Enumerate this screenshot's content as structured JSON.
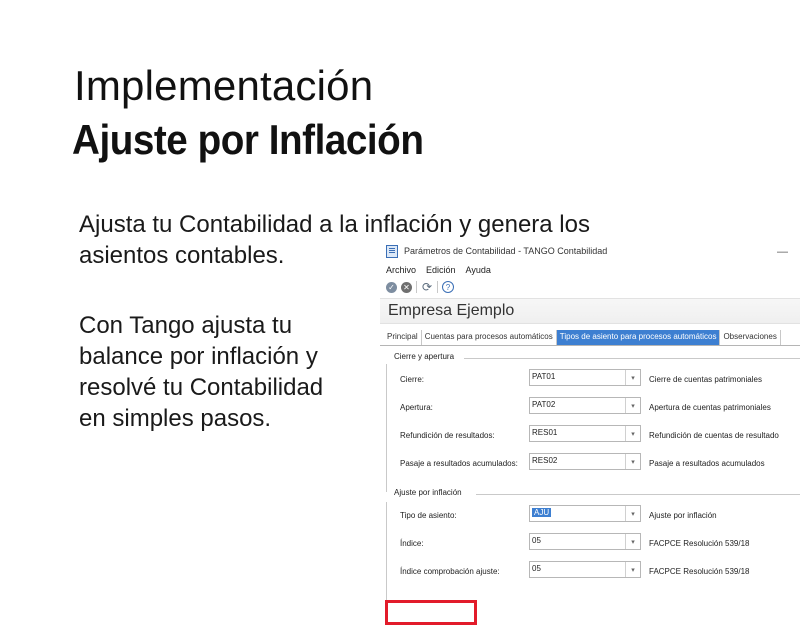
{
  "slide": {
    "title_line1": "Implementación",
    "title_line2": "Ajuste por Inflación",
    "paragraph1_line1": "Ajusta tu Contabilidad a la inflación y genera los",
    "paragraph1_line2": "asientos contables.",
    "paragraph2_line1": "Con Tango ajusta tu",
    "paragraph2_line2": "balance por inflación y",
    "paragraph2_line3": "resolvé tu Contabilidad",
    "paragraph2_line4": "en simples pasos."
  },
  "window": {
    "title": "Parámetros de Contabilidad - TANGO Contabilidad",
    "minimize_glyph": "—",
    "menu": [
      "Archivo",
      "Edición",
      "Ayuda"
    ],
    "toolbar_icons": [
      "ok-icon",
      "cancel-icon",
      "refresh-icon",
      "help-icon"
    ],
    "company": "Empresa Ejemplo",
    "tabs": [
      "Principal",
      "Cuentas para procesos automáticos",
      "Tipos de asiento para procesos automáticos",
      "Observaciones"
    ],
    "active_tab_index": 2,
    "group1": {
      "title": "Cierre y apertura",
      "rows": [
        {
          "label": "Cierre:",
          "value": "PAT01",
          "desc": "Cierre de cuentas patrimoniales"
        },
        {
          "label": "Apertura:",
          "value": "PAT02",
          "desc": "Apertura de cuentas patrimoniales"
        },
        {
          "label": "Refundición de resultados:",
          "value": "RES01",
          "desc": "Refundición de cuentas de resultado"
        },
        {
          "label": "Pasaje a resultados acumulados:",
          "value": "RES02",
          "desc": "Pasaje a resultados acumulados"
        }
      ]
    },
    "group2": {
      "title": "Ajuste por inflación",
      "rows": [
        {
          "label": "Tipo de asiento:",
          "value": "AJU",
          "desc": "Ajuste por inflación"
        },
        {
          "label": "Índice:",
          "value": "05",
          "desc": "FACPCE Resolución 539/18"
        },
        {
          "label": "Índice comprobación ajuste:",
          "value": "05",
          "desc": "FACPCE Resolución 539/18"
        }
      ]
    },
    "highlight_color": "#e21b2a",
    "accent_color": "#3d7fd1"
  }
}
